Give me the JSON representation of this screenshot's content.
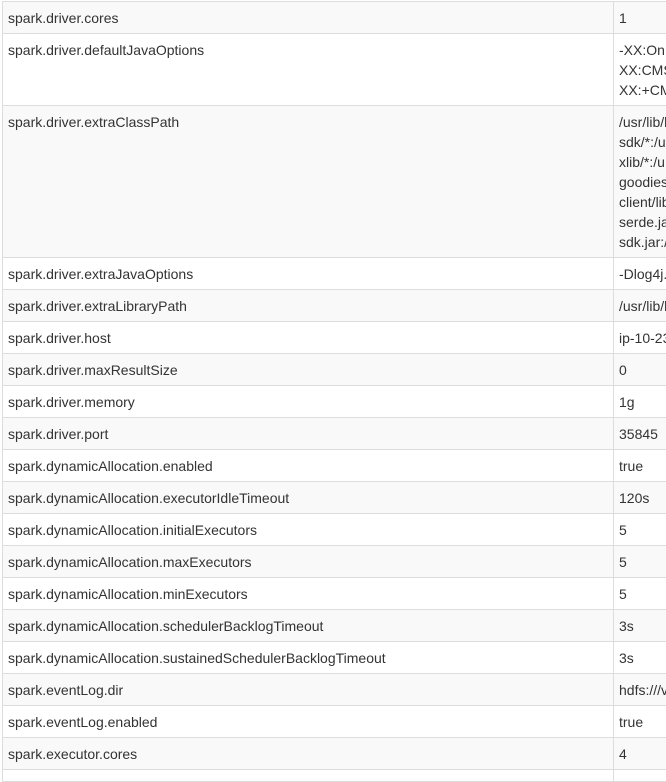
{
  "properties": [
    {
      "name": "spark.driver.cores",
      "value_lines": [
        "1"
      ]
    },
    {
      "name": "spark.driver.defaultJavaOptions",
      "value_lines": [
        "-XX:On",
        "XX:CMS",
        "XX:+CM"
      ]
    },
    {
      "name": "spark.driver.extraClassPath",
      "value_lines": [
        "/usr/lib/l",
        "sdk/*:/u",
        "xlib/*:/u",
        "goodies",
        "client/lib",
        "serde.ja",
        "sdk.jar:/"
      ]
    },
    {
      "name": "spark.driver.extraJavaOptions",
      "value_lines": [
        "-Dlog4j."
      ]
    },
    {
      "name": "spark.driver.extraLibraryPath",
      "value_lines": [
        "/usr/lib/l"
      ]
    },
    {
      "name": "spark.driver.host",
      "value_lines": [
        "ip-10-23"
      ]
    },
    {
      "name": "spark.driver.maxResultSize",
      "value_lines": [
        "0"
      ]
    },
    {
      "name": "spark.driver.memory",
      "value_lines": [
        "1g"
      ]
    },
    {
      "name": "spark.driver.port",
      "value_lines": [
        "35845"
      ]
    },
    {
      "name": "spark.dynamicAllocation.enabled",
      "value_lines": [
        "true"
      ]
    },
    {
      "name": "spark.dynamicAllocation.executorIdleTimeout",
      "value_lines": [
        "120s"
      ]
    },
    {
      "name": "spark.dynamicAllocation.initialExecutors",
      "value_lines": [
        "5"
      ]
    },
    {
      "name": "spark.dynamicAllocation.maxExecutors",
      "value_lines": [
        "5"
      ]
    },
    {
      "name": "spark.dynamicAllocation.minExecutors",
      "value_lines": [
        "5"
      ]
    },
    {
      "name": "spark.dynamicAllocation.schedulerBacklogTimeout",
      "value_lines": [
        "3s"
      ]
    },
    {
      "name": "spark.dynamicAllocation.sustainedSchedulerBacklogTimeout",
      "value_lines": [
        "3s"
      ]
    },
    {
      "name": "spark.eventLog.dir",
      "value_lines": [
        "hdfs:///v"
      ]
    },
    {
      "name": "spark.eventLog.enabled",
      "value_lines": [
        "true"
      ]
    },
    {
      "name": "spark.executor.cores",
      "value_lines": [
        "4"
      ]
    },
    {
      "name": "",
      "value_lines": [
        ""
      ]
    }
  ]
}
